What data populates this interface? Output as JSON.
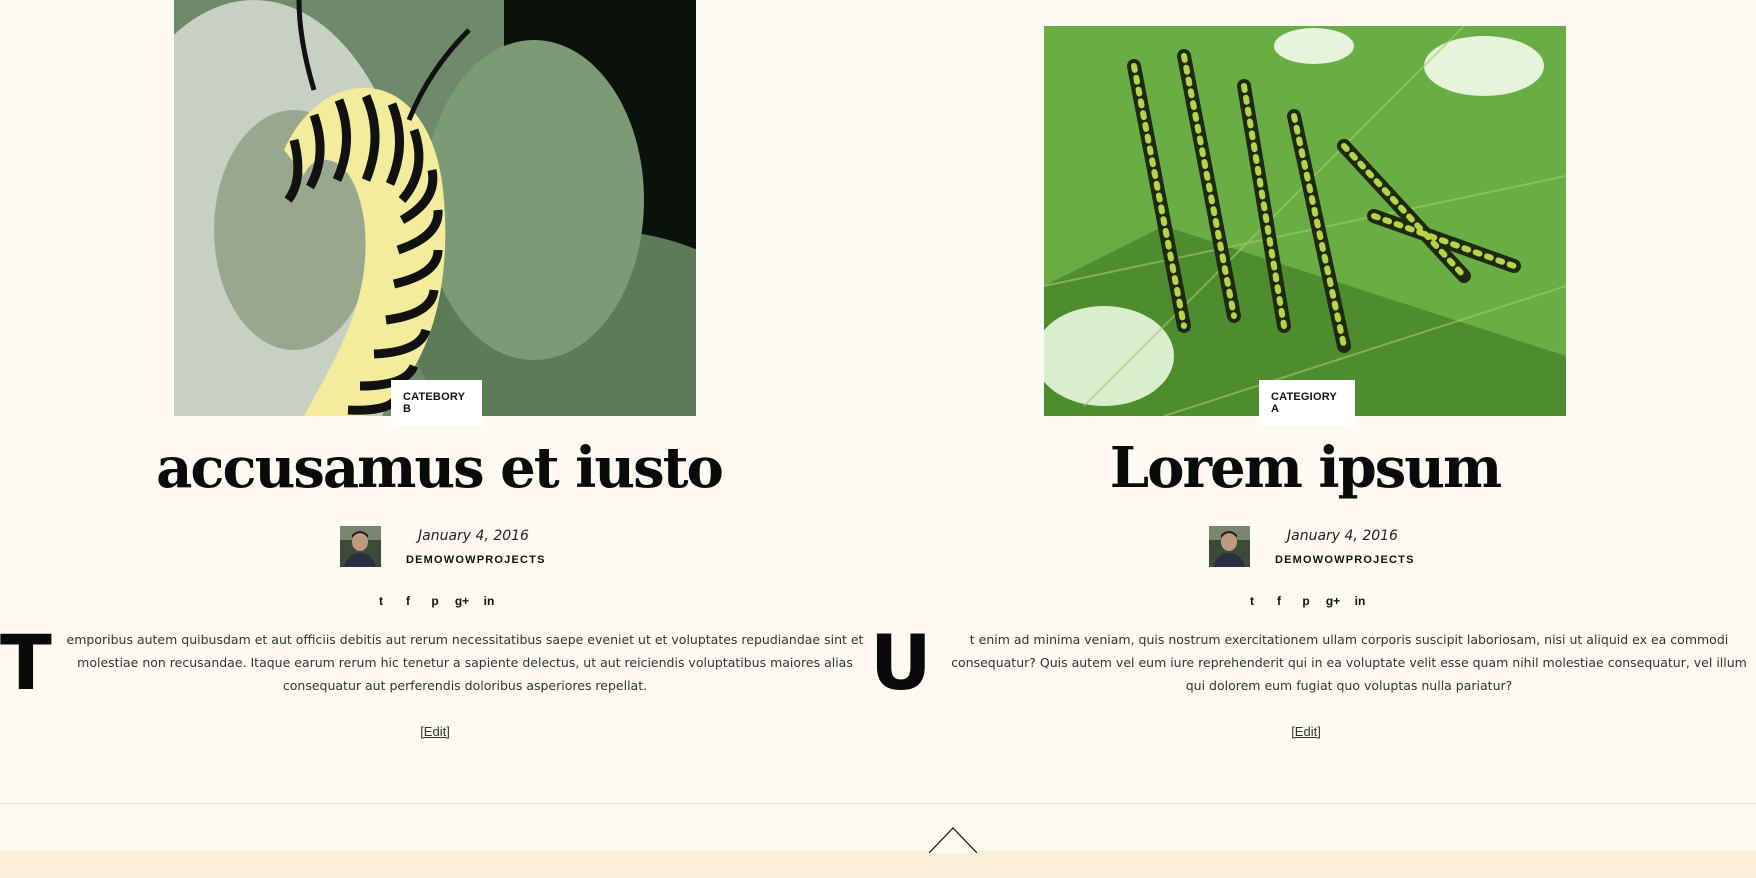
{
  "posts": [
    {
      "category": "CATEBORY B",
      "title": "accusamus et iusto",
      "date": "January 4, 2016",
      "author": "DEMOWOWPROJECTS",
      "dropcap": "T",
      "excerpt": "emporibus autem quibusdam et aut officiis debitis aut rerum necessitatibus saepe eveniet ut et voluptates repudiandae sint et molestiae non recusandae. Itaque earum rerum hic tenetur a sapiente delectus, ut aut reiciendis voluptatibus maiores alias consequatur aut perferendis doloribus asperiores repellat.",
      "edit_label": "[Edit]"
    },
    {
      "category": "CATEGIORY A",
      "title": "Lorem ipsum",
      "date": "January 4, 2016",
      "author": "DEMOWOWPROJECTS",
      "dropcap": "U",
      "excerpt": "t enim ad minima veniam, quis nostrum exercitationem ullam corporis suscipit laboriosam, nisi ut aliquid ex ea commodi consequatur? Quis autem vel eum iure reprehenderit qui in ea voluptate velit esse quam nihil molestiae consequatur, vel illum qui dolorem eum fugiat quo voluptas nulla pariatur?",
      "edit_label": "[Edit]"
    }
  ],
  "share_icons": [
    "twitter-icon",
    "facebook-icon",
    "pinterest-icon",
    "google-plus-icon",
    "linkedin-icon"
  ],
  "share_glyphs": [
    "t",
    "f",
    "p",
    "g+",
    "in"
  ],
  "back_to_top_icon": "chevron-up-icon",
  "colors": {
    "background": "#fdfaf4",
    "footer": "#fbefd7",
    "text": "#111111"
  }
}
